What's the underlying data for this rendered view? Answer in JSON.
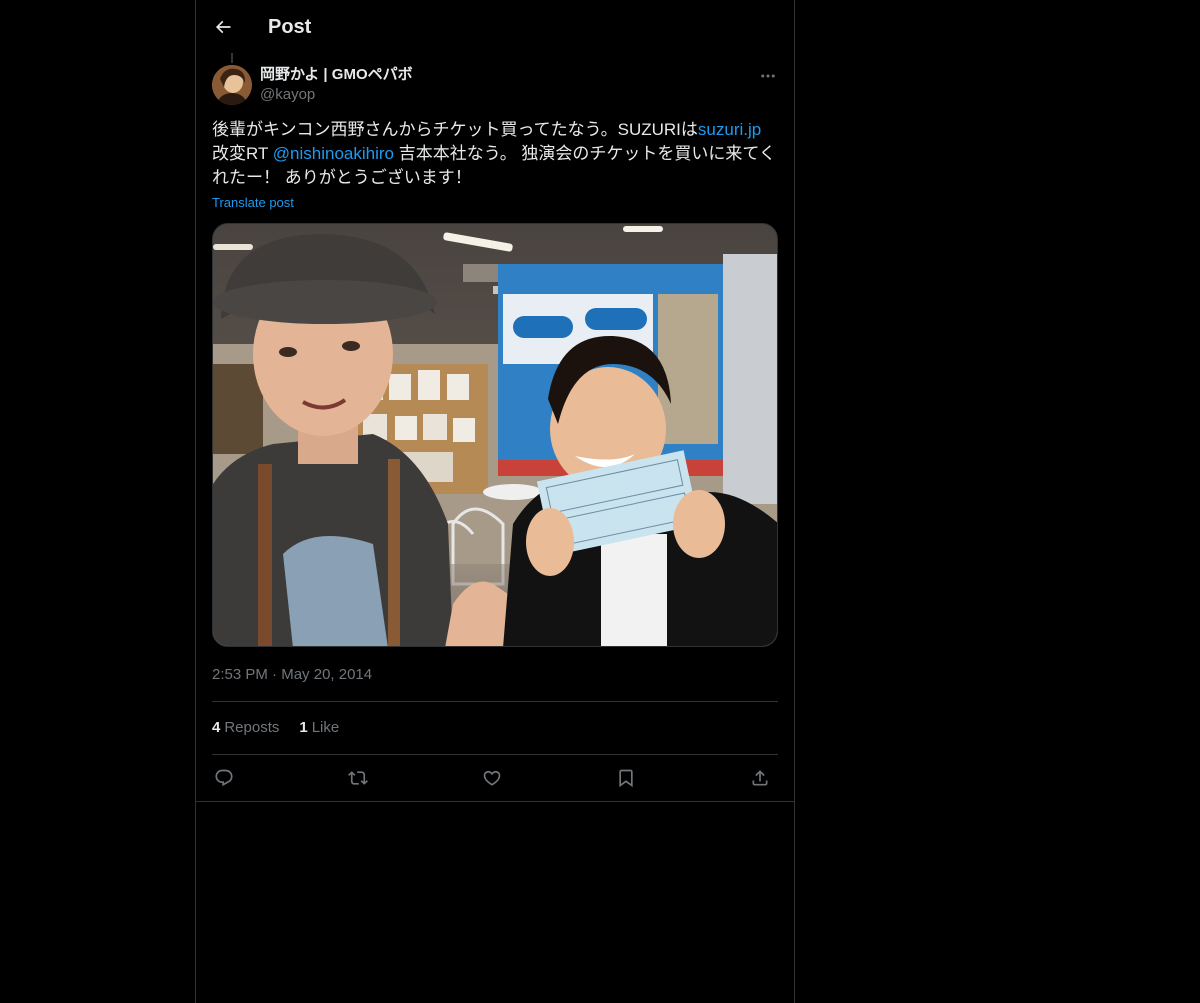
{
  "header": {
    "title": "Post",
    "back_icon": "arrow-left-icon"
  },
  "post": {
    "author": {
      "display_name": "岡野かよ | GMOペパボ",
      "handle": "@kayop"
    },
    "text_segments": [
      {
        "type": "text",
        "value": "後輩がキンコン西野さんからチケット買ってたなう。SUZURIは"
      },
      {
        "type": "link",
        "value": "suzuri.jp"
      },
      {
        "type": "text",
        "value": " 改変RT "
      },
      {
        "type": "link",
        "value": "@nishinoakihiro"
      },
      {
        "type": "text",
        "value": " 吉本本社なう。 独演会のチケットを買いに来てくれたー！ ありがとうございます！"
      }
    ],
    "translate_label": "Translate post",
    "time": "2:53 PM",
    "separator": "·",
    "date": "May 20, 2014",
    "stats": {
      "reposts_count": "4",
      "reposts_label": "Reposts",
      "likes_count": "1",
      "likes_label": "Like"
    },
    "actions": [
      {
        "name": "reply",
        "icon": "reply-icon"
      },
      {
        "name": "repost",
        "icon": "repost-icon"
      },
      {
        "name": "like",
        "icon": "heart-icon"
      },
      {
        "name": "bookmark",
        "icon": "bookmark-icon"
      },
      {
        "name": "share",
        "icon": "share-icon"
      }
    ]
  },
  "colors": {
    "background": "#000000",
    "text_primary": "#e7e9ea",
    "text_secondary": "#71767b",
    "link": "#1d9bf0",
    "border": "#2f3336"
  }
}
